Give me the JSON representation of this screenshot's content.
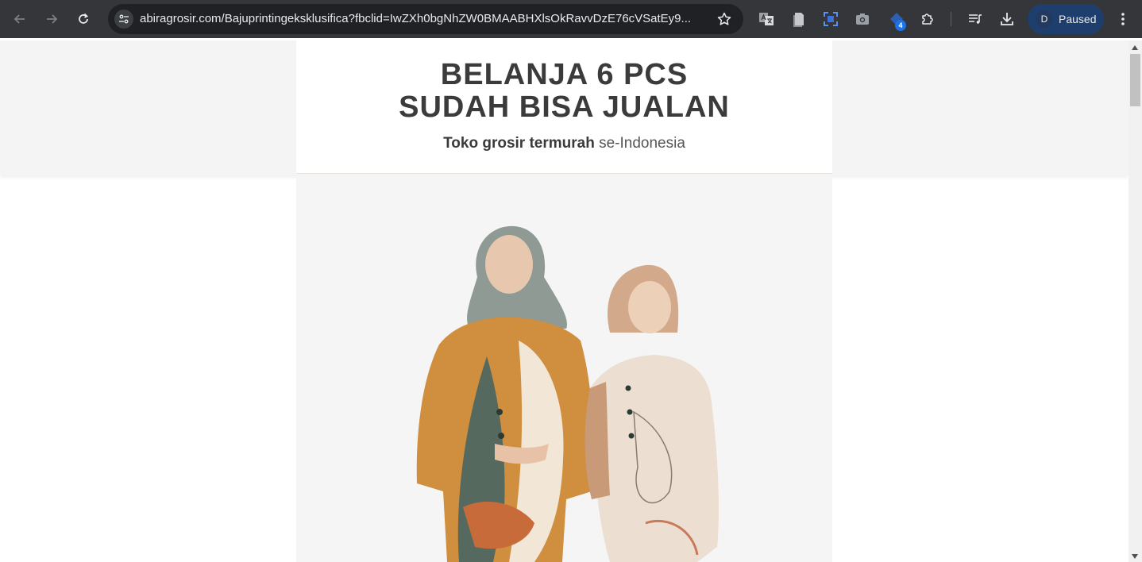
{
  "browser": {
    "url": "abiragrosir.com/Bajuprintingeksklusifica?fbclid=IwZXh0bgNhZW0BMAABHXlsOkRavvDzE76cVSatEy9...",
    "extension_badge": "4",
    "profile_initial": "D",
    "profile_status": "Paused",
    "colors": {
      "toolbar": "#35363a",
      "omnibox": "#202124",
      "profile": "#1e3f6e",
      "accent": "#1a73e8"
    }
  },
  "page": {
    "headline_line1": "BELANJA 6 PCS",
    "headline_line2": "SUDAH BISA JUALAN",
    "sub_bold": "Toko grosir termurah",
    "sub_rest": " se-Indonesia",
    "hero_image": "two-women-hijab-printed-shirts-photo",
    "colors": {
      "headline": "#3b3b3b",
      "band": "#f4f4f5"
    }
  }
}
